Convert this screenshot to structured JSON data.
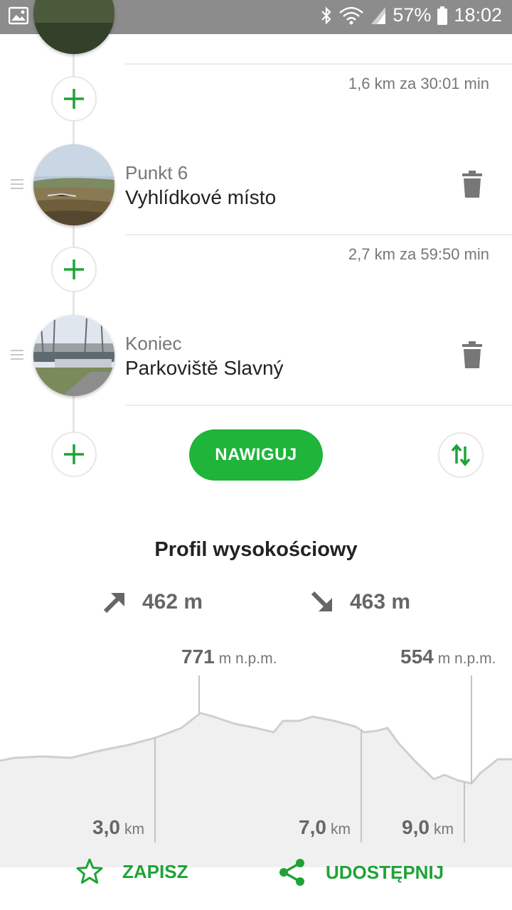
{
  "status_bar": {
    "battery": "57%",
    "time": "18:02",
    "icons": [
      "gallery-icon",
      "app-notification-icon",
      "volume-icon",
      "bluetooth-icon",
      "wifi-icon",
      "signal-icon",
      "battery-icon"
    ]
  },
  "route": {
    "legs": [
      {
        "info": "1,6 km za 30:01 min"
      },
      {
        "info": "2,7 km za 59:50 min"
      }
    ],
    "points": [
      {
        "label": "Punkt 6",
        "name": "Vyhlídkové místo"
      },
      {
        "label": "Koniec",
        "name": "Parkoviště Slavný"
      }
    ],
    "navigate_label": "NAWIGUJ"
  },
  "profile": {
    "title": "Profil wysokościowy",
    "ascent": "462 m",
    "descent": "463 m",
    "peaks": [
      {
        "value": "771",
        "unit": "m n.p.m."
      },
      {
        "value": "554",
        "unit": "m n.p.m."
      }
    ],
    "distance_marks": [
      {
        "value": "3,0",
        "unit": "km"
      },
      {
        "value": "7,0",
        "unit": "km"
      },
      {
        "value": "9,0",
        "unit": "km"
      }
    ]
  },
  "actions": {
    "save_label": "ZAPISZ",
    "share_label": "UDOSTĘPNIJ"
  },
  "colors": {
    "accent_green": "#1fb43a",
    "status_bar": "#8c8c8c",
    "profile_fill": "#f0f0f0"
  }
}
